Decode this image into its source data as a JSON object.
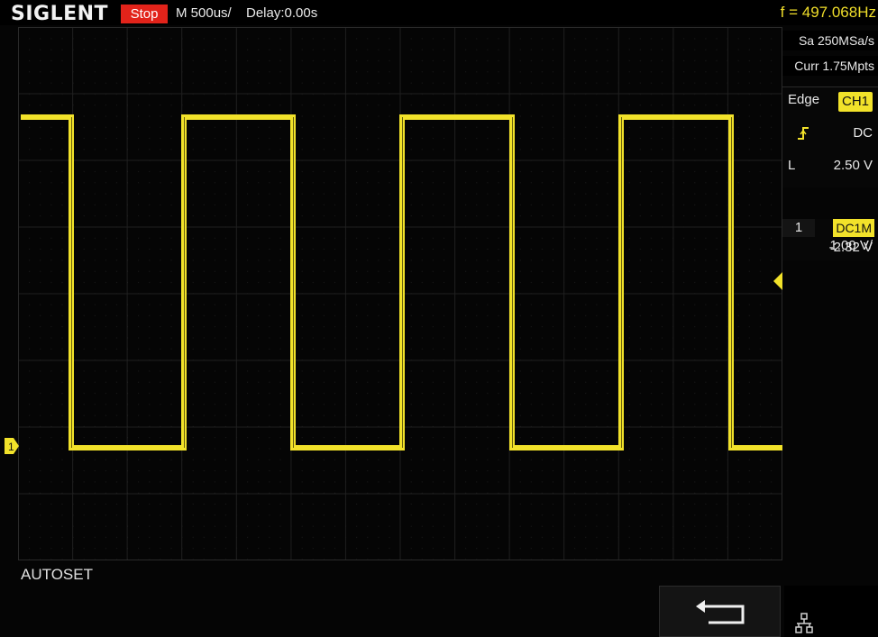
{
  "header": {
    "brand": "SIGLENT",
    "run_state": "Stop",
    "timebase": "M 500us/",
    "delay": "Delay:0.00s",
    "frequency": "f = 497.068Hz"
  },
  "acquisition": {
    "sample_rate": "Sa 250MSa/s",
    "memory_depth": "Curr 1.75Mpts"
  },
  "trigger": {
    "type": "Edge",
    "source": "CH1",
    "slope_icon": "rising-edge-icon",
    "coupling": "DC",
    "level_label": "L",
    "level": "2.50 V"
  },
  "channel1": {
    "number": "1",
    "coupling": "DC1M",
    "scale": "1.00 V/",
    "offset": "-2.32 V",
    "ground_marker": "1"
  },
  "status_message": "AUTOSET",
  "softkeys": {
    "back_icon": "return-arrow-icon",
    "network_icon": "network-icon"
  },
  "colors": {
    "channel1": "#f2e22a",
    "trigger_position": "#29a9e0",
    "stop": "#e2231a"
  }
}
